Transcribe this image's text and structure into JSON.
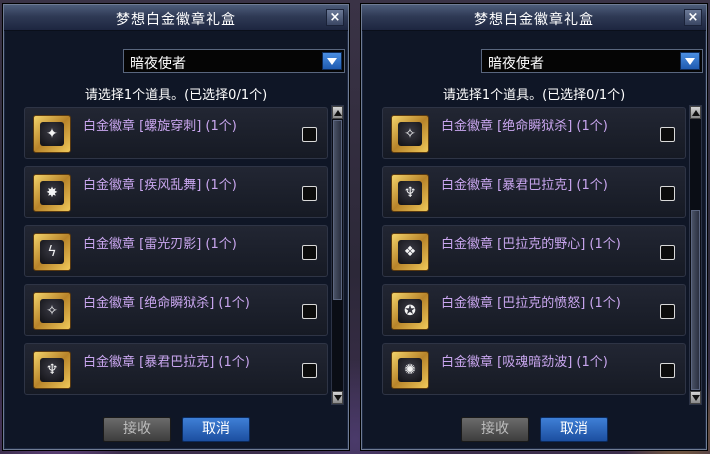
{
  "dialogs": [
    {
      "title": "梦想白金徽章礼盒",
      "close_label": "×",
      "dropdown_value": "暗夜使者",
      "prompt": "请选择1个道具。(已选择0/1个)",
      "items": [
        {
          "name": "白金徽章 [螺旋穿刺] (1个)",
          "icon": "spiral-pierce-icon",
          "glyph": "✦",
          "checked": false
        },
        {
          "name": "白金徽章 [疾风乱舞] (1个)",
          "icon": "wind-dance-icon",
          "glyph": "✸",
          "checked": false
        },
        {
          "name": "白金徽章 [雷光刃影] (1个)",
          "icon": "lightning-blade-icon",
          "glyph": "ϟ",
          "checked": false
        },
        {
          "name": "白金徽章 [绝命瞬狱杀] (1个)",
          "icon": "fatal-strike-icon",
          "glyph": "✧",
          "checked": false
        },
        {
          "name": "白金徽章 [暴君巴拉克] (1个)",
          "icon": "tyrant-barak-icon",
          "glyph": "♆",
          "checked": false
        }
      ],
      "accept_label": "接收",
      "cancel_label": "取消",
      "scroll_position": 0.0
    },
    {
      "title": "梦想白金徽章礼盒",
      "close_label": "×",
      "dropdown_value": "暗夜使者",
      "prompt": "请选择1个道具。(已选择0/1个)",
      "items": [
        {
          "name": "白金徽章 [绝命瞬狱杀] (1个)",
          "icon": "fatal-strike-icon",
          "glyph": "✧",
          "checked": false
        },
        {
          "name": "白金徽章 [暴君巴拉克] (1个)",
          "icon": "tyrant-barak-icon",
          "glyph": "♆",
          "checked": false
        },
        {
          "name": "白金徽章 [巴拉克的野心] (1个)",
          "icon": "barak-ambition-icon",
          "glyph": "❖",
          "checked": false
        },
        {
          "name": "白金徽章 [巴拉克的愤怒] (1个)",
          "icon": "barak-wrath-icon",
          "glyph": "✪",
          "checked": false
        },
        {
          "name": "白金徽章 [吸魂暗劲波] (1个)",
          "icon": "soul-drain-icon",
          "glyph": "✺",
          "checked": false
        }
      ],
      "accept_label": "接收",
      "cancel_label": "取消",
      "scroll_position": 0.62
    }
  ],
  "colors": {
    "item_text": "#c9a6ef",
    "cancel_button": "#2a62bd",
    "accept_button_disabled": "#555555"
  }
}
